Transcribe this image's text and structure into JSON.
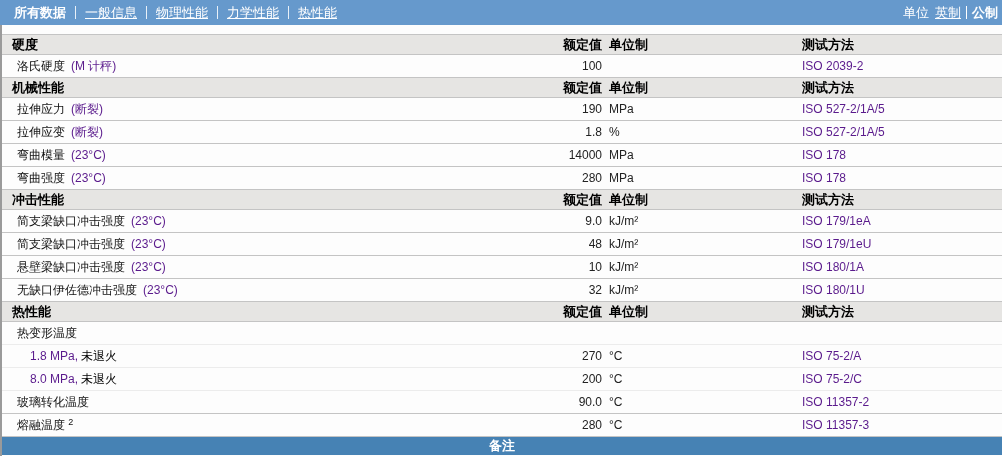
{
  "nav": {
    "tabs": [
      {
        "label": "所有数据",
        "selected": true
      },
      {
        "label": "一般信息",
        "selected": false
      },
      {
        "label": "物理性能",
        "selected": false
      },
      {
        "label": "力学性能",
        "selected": false
      },
      {
        "label": "热性能",
        "selected": false
      }
    ],
    "units_label": "单位",
    "units": [
      {
        "label": "英制",
        "selected": false
      },
      {
        "label": "公制",
        "selected": true
      }
    ]
  },
  "sections": [
    {
      "title": "硬度",
      "columns": [
        "额定值",
        "单位制",
        "测试方法"
      ],
      "rows": [
        {
          "kind": "main",
          "name": "洛氏硬度",
          "condition": "(M 计秤)",
          "value": "100",
          "method": "ISO 2039-2"
        }
      ]
    },
    {
      "title": "机械性能",
      "columns": [
        "额定值",
        "单位制",
        "测试方法"
      ],
      "rows": [
        {
          "kind": "main",
          "name": "拉伸应力",
          "condition": "(断裂)",
          "value": "190",
          "unit": "MPa",
          "method": "ISO 527-2/1A/5"
        },
        {
          "kind": "main",
          "name": "拉伸应变",
          "condition": "(断裂)",
          "value": "1.8",
          "unit": "%",
          "method": "ISO 527-2/1A/5"
        },
        {
          "kind": "main",
          "name": "弯曲模量",
          "condition": "(23°C)",
          "value": "14000",
          "unit": "MPa",
          "method": "ISO 178"
        },
        {
          "kind": "main",
          "name": "弯曲强度",
          "condition": "(23°C)",
          "value": "280",
          "unit": "MPa",
          "method": "ISO 178"
        }
      ]
    },
    {
      "title": "冲击性能",
      "columns": [
        "额定值",
        "单位制",
        "测试方法"
      ],
      "rows": [
        {
          "kind": "main",
          "name": "简支梁缺口冲击强度",
          "condition": "(23°C)",
          "value": "9.0",
          "unit": "kJ/m²",
          "method": "ISO 179/1eA"
        },
        {
          "kind": "main",
          "name": "简支梁缺口冲击强度",
          "condition": "(23°C)",
          "value": "48",
          "unit": "kJ/m²",
          "method": "ISO 179/1eU"
        },
        {
          "kind": "main",
          "name": "悬壁梁缺口冲击强度",
          "condition": "(23°C)",
          "value": "10",
          "unit": "kJ/m²",
          "method": "ISO 180/1A"
        },
        {
          "kind": "main",
          "name": "无缺口伊佐德冲击强度",
          "condition": "(23°C)",
          "value": "32",
          "unit": "kJ/m²",
          "method": "ISO 180/1U"
        }
      ]
    },
    {
      "title": "热性能",
      "columns": [
        "额定值",
        "单位制",
        "测试方法"
      ],
      "rows": [
        {
          "kind": "main",
          "name": "热变形温度"
        },
        {
          "kind": "sub",
          "condition": "1.8 MPa,",
          "name": "未退火",
          "value": "270",
          "unit": "°C",
          "method": "ISO 75-2/A"
        },
        {
          "kind": "sub",
          "condition": "8.0 MPa,",
          "name": "未退火",
          "value": "200",
          "unit": "°C",
          "method": "ISO 75-2/C"
        },
        {
          "kind": "main",
          "name": "玻璃转化温度",
          "value": "90.0",
          "unit": "°C",
          "method": "ISO 11357-2"
        },
        {
          "kind": "main",
          "name": "熔融温度 $^{2}$",
          "value": "280",
          "unit": "°C",
          "method": "ISO 11357-3"
        }
      ]
    }
  ],
  "notes_title": "备注"
}
